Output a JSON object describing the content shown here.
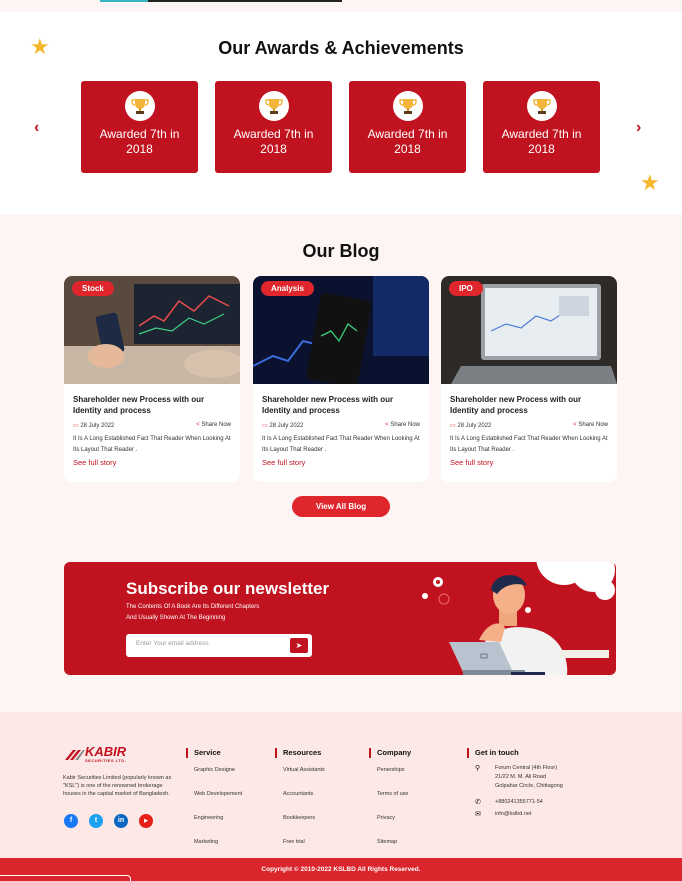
{
  "colors": {
    "primary": "#c1121f",
    "accent": "#e0262d",
    "footer_bg": "#fce8e6",
    "star": "#f5b82e"
  },
  "awards": {
    "title": "Our Awards & Achievements",
    "cards": [
      {
        "label": "Awarded 7th in 2018",
        "icon": "trophy-icon"
      },
      {
        "label": "Awarded 7th in 2018",
        "icon": "trophy-icon"
      },
      {
        "label": "Awarded 7th in 2018",
        "icon": "trophy-icon"
      },
      {
        "label": "Awarded 7th in 2018",
        "icon": "trophy-icon"
      }
    ],
    "prev_icon": "chevron-left-icon",
    "next_icon": "chevron-right-icon"
  },
  "blog": {
    "title": "Our Blog",
    "posts": [
      {
        "tag": "Stock",
        "title": "Shareholder new Process with our Identity and process",
        "date": "28 July 2022",
        "share": "Share Now",
        "desc": "It Is A Long Established Fact That Reader When Looking At Its Layout That Reader .",
        "more": "See full story"
      },
      {
        "tag": "Analysis",
        "title": "Shareholder new Process with our Identity and process",
        "date": "28 July 2022",
        "share": "Share Now",
        "desc": "It Is A Long Established Fact That Reader When Looking At Its Layout That Reader .",
        "more": "See full story"
      },
      {
        "tag": "IPO",
        "title": "Shareholder new Process with our Identity and process",
        "date": "28 July 2022",
        "share": "Share Now",
        "desc": "It Is A Long Established Fact That Reader When Looking At Its Layout That Reader .",
        "more": "See full story"
      }
    ],
    "view_all": "View All Blog"
  },
  "newsletter": {
    "title": "Subscribe our newsletter",
    "line1": "The Contents Of A Book Are Its Different Chapters",
    "line2": "And Usually Shown  At The Beginning",
    "placeholder": "Enter Your email address"
  },
  "footer": {
    "logo_big": "KABIR",
    "logo_small": "SECURITIES LTD.",
    "description": "Kabir Securities Limited (popularly known as \"KSL\") is one of the renowned brokerage houses in the capital market of Bangladesh.",
    "socials": [
      {
        "icon": "facebook-icon",
        "glyph": "f",
        "color": "#1877f2"
      },
      {
        "icon": "twitter-icon",
        "glyph": "t",
        "color": "#1da1f2"
      },
      {
        "icon": "linkedin-icon",
        "glyph": "in",
        "color": "#0a66c2"
      },
      {
        "icon": "youtube-icon",
        "glyph": "▶",
        "color": "#e62117"
      }
    ],
    "service": {
      "title": "Service",
      "items": [
        "Graphic Designe",
        "Web Developement",
        "Engineering",
        "Marketing"
      ]
    },
    "resources": {
      "title": "Resources",
      "items": [
        "Virtual Assistants",
        "Accountants",
        "Bookkeepers",
        "Free trial"
      ]
    },
    "company": {
      "title": "Company",
      "items": [
        "Penerships",
        "Terms of use",
        "Privacy",
        "Sitemap"
      ]
    },
    "touch": {
      "title": "Get in touch",
      "address1": "Forum Central (4th Floor)",
      "address2": "21/22 M. M. Ali Road",
      "address3": "Golpahar Circle, Chittagong",
      "phone": "+880241355771-54",
      "email": "info@kslbd.net"
    }
  },
  "copyright": "Copyright ©  2010-2022 KSLBD All Rights Reserved."
}
